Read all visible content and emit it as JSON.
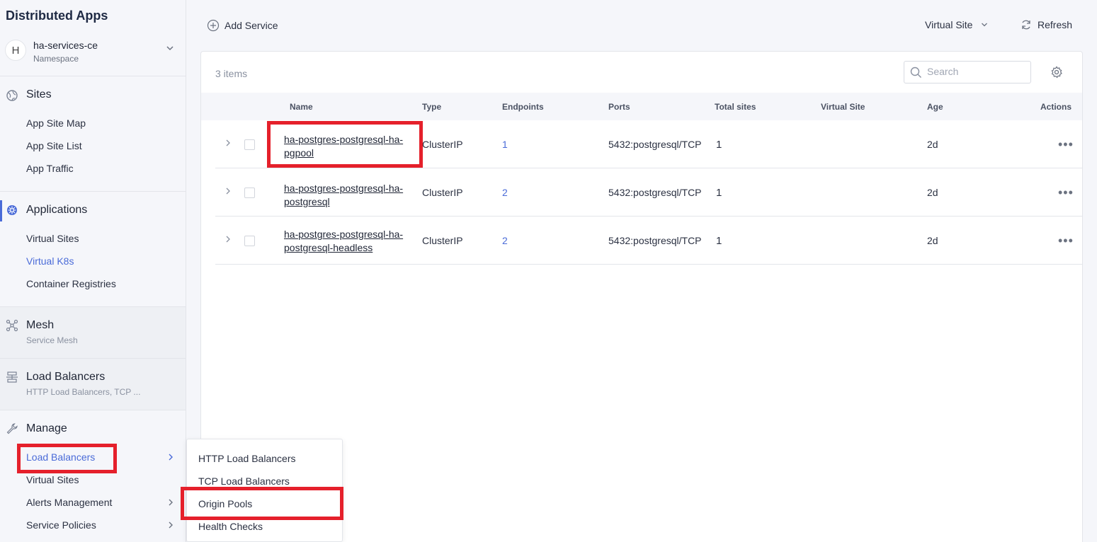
{
  "app": {
    "title": "Distributed Apps"
  },
  "namespace": {
    "avatar": "H",
    "name": "ha-services-ce",
    "label": "Namespace"
  },
  "sidebar": {
    "sites": {
      "title": "Sites",
      "items": [
        "App Site Map",
        "App Site List",
        "App Traffic"
      ]
    },
    "applications": {
      "title": "Applications",
      "items": [
        "Virtual Sites",
        "Virtual K8s",
        "Container Registries"
      ]
    },
    "mesh": {
      "title": "Mesh",
      "subtitle": "Service Mesh"
    },
    "load_balancers": {
      "title": "Load Balancers",
      "subtitle": "HTTP Load Balancers, TCP ..."
    },
    "manage": {
      "title": "Manage",
      "items": [
        "Load Balancers",
        "Virtual Sites",
        "Alerts Management",
        "Service Policies"
      ]
    }
  },
  "toolbar": {
    "add_service": "Add Service",
    "virtual_site": "Virtual Site",
    "refresh": "Refresh"
  },
  "table": {
    "items_count": "3 items",
    "search_placeholder": "Search",
    "columns": [
      "Name",
      "Type",
      "Endpoints",
      "Ports",
      "Total sites",
      "Virtual Site",
      "Age",
      "Actions"
    ],
    "rows": [
      {
        "name_line1": "ha-postgres-postgresql-ha-",
        "name_line2": "pgpool",
        "type": "ClusterIP",
        "endpoints": "1",
        "ports": "5432:postgresql/TCP",
        "total_sites": "1",
        "virtual_site": "",
        "age": "2d"
      },
      {
        "name_line1": "ha-postgres-postgresql-ha-",
        "name_line2": "postgresql",
        "type": "ClusterIP",
        "endpoints": "2",
        "ports": "5432:postgresql/TCP",
        "total_sites": "1",
        "virtual_site": "",
        "age": "2d"
      },
      {
        "name_line1": "ha-postgres-postgresql-ha-",
        "name_line2": "postgresql-headless",
        "type": "ClusterIP",
        "endpoints": "2",
        "ports": "5432:postgresql/TCP",
        "total_sites": "1",
        "virtual_site": "",
        "age": "2d"
      }
    ]
  },
  "flyout": {
    "items": [
      "HTTP Load Balancers",
      "TCP Load Balancers",
      "Origin Pools",
      "Health Checks"
    ]
  },
  "colors": {
    "accent": "#4a6bd8",
    "highlight": "#e5202b"
  }
}
